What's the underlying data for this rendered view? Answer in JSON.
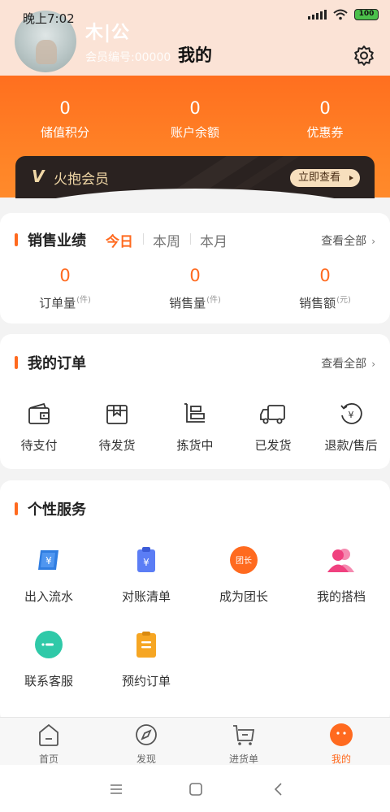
{
  "status_bar": {
    "time": "晚上7:02",
    "battery": "100"
  },
  "header": {
    "title": "我的",
    "user_name": "木|公",
    "member_no": "会员编号:00000"
  },
  "stats": [
    {
      "value": "0",
      "label": "储值积分"
    },
    {
      "value": "0",
      "label": "账户余额"
    },
    {
      "value": "0",
      "label": "优惠券"
    }
  ],
  "vip": {
    "logo": "V",
    "name": "火抱会员",
    "button": "立即查看"
  },
  "sales": {
    "title": "销售业绩",
    "tabs": [
      "今日",
      "本周",
      "本月"
    ],
    "active_tab": "今日",
    "see_all": "查看全部",
    "metrics": [
      {
        "value": "0",
        "label": "订单量",
        "unit": "(件)"
      },
      {
        "value": "0",
        "label": "销售量",
        "unit": "(件)"
      },
      {
        "value": "0",
        "label": "销售额",
        "unit": "(元)"
      }
    ]
  },
  "orders": {
    "title": "我的订单",
    "see_all": "查看全部",
    "items": [
      {
        "label": "待支付",
        "icon": "wallet-icon"
      },
      {
        "label": "待发货",
        "icon": "box-icon"
      },
      {
        "label": "拣货中",
        "icon": "picking-icon"
      },
      {
        "label": "已发货",
        "icon": "truck-icon"
      },
      {
        "label": "退款/售后",
        "icon": "refund-icon"
      }
    ]
  },
  "services": {
    "title": "个性服务",
    "items": [
      {
        "label": "出入流水",
        "icon": "flow-icon",
        "color": "#2f7de1"
      },
      {
        "label": "对账清单",
        "icon": "statement-icon",
        "color": "#5b7df5"
      },
      {
        "label": "成为团长",
        "icon": "leader-icon",
        "color": "#ff6a1f",
        "badge": "团长"
      },
      {
        "label": "我的搭档",
        "icon": "partner-icon",
        "color": "#f0417f"
      },
      {
        "label": "联系客服",
        "icon": "service-icon",
        "color": "#2fc9a8"
      },
      {
        "label": "预约订单",
        "icon": "reservation-icon",
        "color": "#f6a623"
      }
    ]
  },
  "bottom_nav": [
    {
      "label": "首页",
      "icon": "home-icon"
    },
    {
      "label": "发现",
      "icon": "discover-icon"
    },
    {
      "label": "进货单",
      "icon": "cart-icon"
    },
    {
      "label": "我的",
      "icon": "profile-icon",
      "active": true
    }
  ],
  "colors": {
    "accent": "#ff6a1f",
    "header_bg": "#fbe3d6",
    "vip_card": "#2a2220"
  }
}
